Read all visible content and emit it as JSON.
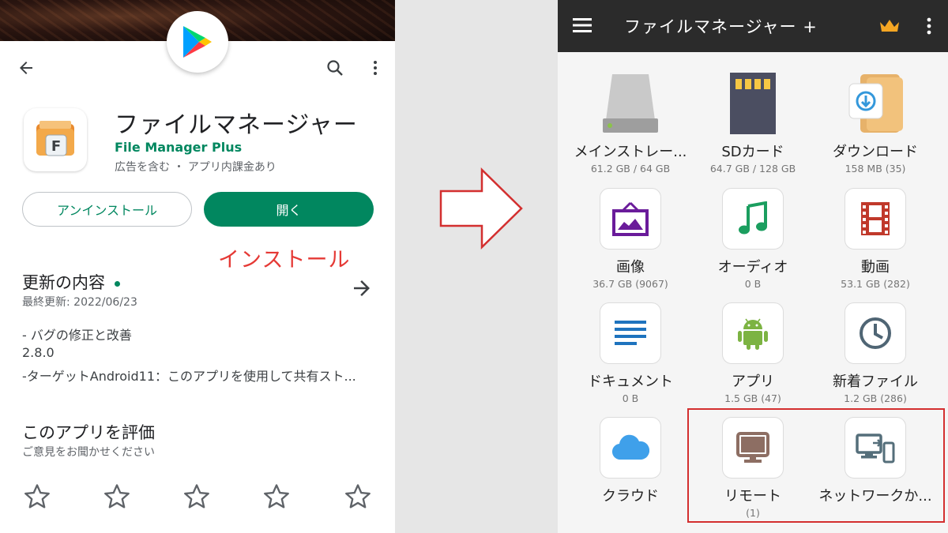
{
  "left_panel": {
    "title": "ファイルマネージャー",
    "developer": "File Manager Plus",
    "meta": "広告を含む ・ アプリ内課金あり",
    "buttons": {
      "uninstall": "アンインストール",
      "open": "開く"
    },
    "annotation": "インストール",
    "whats_new": {
      "title": "更新の内容",
      "last_updated": "最終更新: 2022/06/23",
      "notes": [
        "- バグの修正と改善",
        "2.8.0",
        "-ターゲットAndroid11：このアプリを使用して共有スト..."
      ]
    },
    "rate": {
      "title": "このアプリを評価",
      "subtitle": "ご意見をお聞かせください",
      "stars": 5
    }
  },
  "right_panel": {
    "title": "ファイルマネージャー +",
    "items": [
      {
        "label": "メインストレー...",
        "sub": "61.2 GB / 64 GB",
        "icon": "storage-icon"
      },
      {
        "label": "SDカード",
        "sub": "64.7 GB / 128 GB",
        "icon": "sd-card-icon"
      },
      {
        "label": "ダウンロード",
        "sub": "158 MB (35)",
        "icon": "download-folder-icon"
      },
      {
        "label": "画像",
        "sub": "36.7 GB (9067)",
        "icon": "image-icon"
      },
      {
        "label": "オーディオ",
        "sub": "0 B",
        "icon": "audio-icon"
      },
      {
        "label": "動画",
        "sub": "53.1 GB (282)",
        "icon": "video-icon"
      },
      {
        "label": "ドキュメント",
        "sub": "0 B",
        "icon": "document-icon"
      },
      {
        "label": "アプリ",
        "sub": "1.5 GB (47)",
        "icon": "android-icon"
      },
      {
        "label": "新着ファイル",
        "sub": "1.2 GB (286)",
        "icon": "clock-icon"
      },
      {
        "label": "クラウド",
        "sub": "",
        "icon": "cloud-icon"
      },
      {
        "label": "リモート",
        "sub": "(1)",
        "icon": "remote-monitor-icon"
      },
      {
        "label": "ネットワークか...",
        "sub": "",
        "icon": "network-devices-icon"
      }
    ]
  },
  "colors": {
    "play_green": "#01875f",
    "annotation_red": "#e53935",
    "appbar": "#2b2b2b",
    "crown": "#f5a623"
  }
}
